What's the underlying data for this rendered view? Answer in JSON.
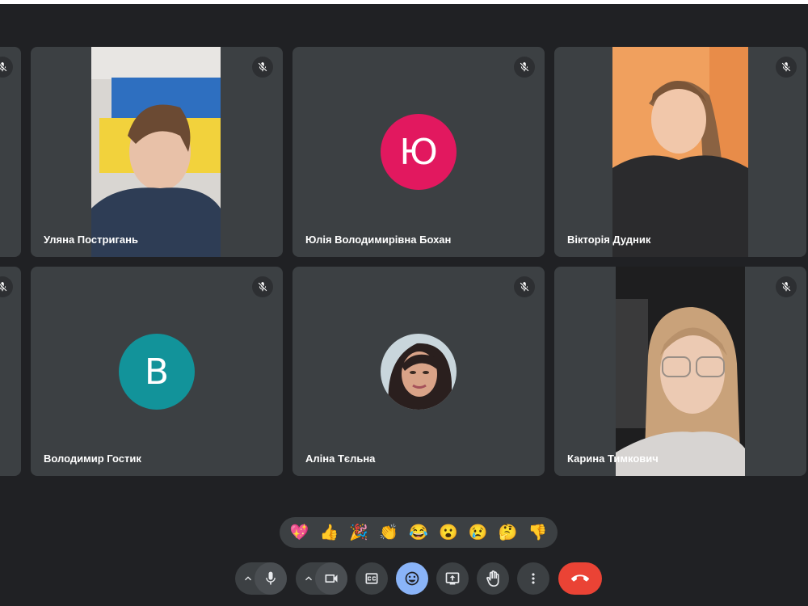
{
  "participants": [
    {
      "name": "Уляна Постригань"
    },
    {
      "name": "Юлія Володимирівна Бохан",
      "initial": "Ю",
      "color": "#e2185f"
    },
    {
      "name": "Вікторія Дудник"
    },
    {
      "name": "Володимир Гостик",
      "initial": "В",
      "color": "#12939a"
    },
    {
      "name": "Аліна Тєльна"
    },
    {
      "name": "Карина Тимкович"
    }
  ],
  "icons": {
    "muted": "mic-off-icon",
    "mic": "mic-icon",
    "camera": "videocam-icon",
    "captions": "closed-captions-icon",
    "reactions": "emoji-icon",
    "present": "present-screen-icon",
    "raise_hand": "hand-icon",
    "more": "more-vert-icon",
    "end_call": "end-call-icon"
  },
  "reactions": [
    "💖",
    "👍",
    "🎉",
    "👏",
    "😂",
    "😮",
    "😢",
    "🤔",
    "👎"
  ],
  "colors": {
    "background": "#202124",
    "tile": "#3c4043",
    "reaction_active": "#8ab4f8",
    "end_call": "#ea4335"
  }
}
